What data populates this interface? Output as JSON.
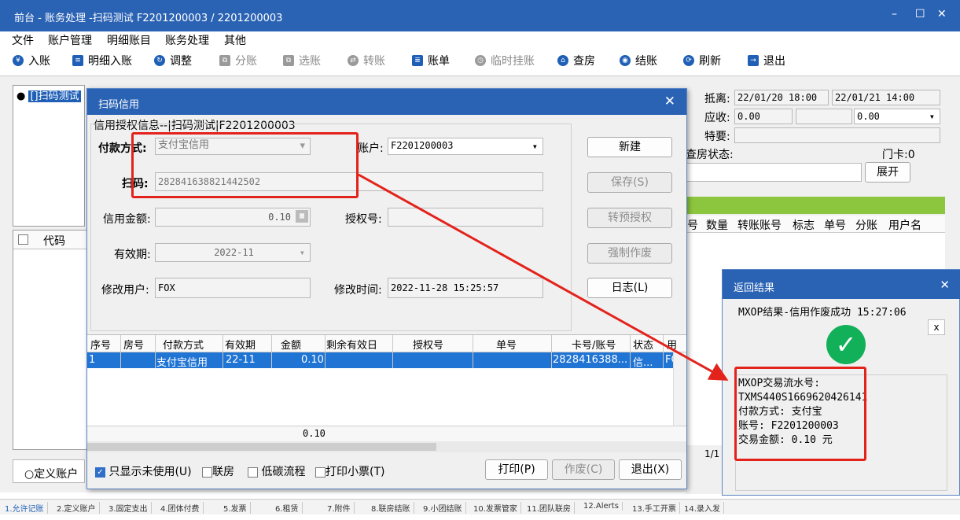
{
  "window": {
    "title": "前台 - 账务处理 -扫码测试  F2201200003  /  2201200003",
    "controls": {
      "minimize": "–",
      "maximize": "☐",
      "close": "✕"
    }
  },
  "menu": [
    "文件",
    "账户管理",
    "明细账目",
    "账务处理",
    "其他"
  ],
  "toolbar": {
    "items": [
      {
        "label": "入账",
        "icon": "yen-icon",
        "enabled": true
      },
      {
        "label": "明细入账",
        "icon": "ledger-icon",
        "enabled": true
      },
      {
        "label": "调整",
        "icon": "adjust-icon",
        "enabled": true
      },
      {
        "label": "分账",
        "icon": "split-icon",
        "enabled": false
      },
      {
        "label": "选账",
        "icon": "select-icon",
        "enabled": false
      },
      {
        "label": "转账",
        "icon": "transfer-icon",
        "enabled": false
      },
      {
        "label": "账单",
        "icon": "bill-icon",
        "enabled": true
      },
      {
        "label": "临时挂账",
        "icon": "clock-icon",
        "enabled": false
      },
      {
        "label": "查房",
        "icon": "house-icon",
        "enabled": true
      },
      {
        "label": "结账",
        "icon": "coins-icon",
        "enabled": true
      },
      {
        "label": "刷新",
        "icon": "refresh-icon",
        "enabled": true
      },
      {
        "label": "退出",
        "icon": "exit-icon",
        "enabled": true
      }
    ]
  },
  "tree": {
    "node_label": "[]扫码测试"
  },
  "code_grid": {
    "header": "代码"
  },
  "bottom_left": {
    "radio_label": "定义账户"
  },
  "right_panel": {
    "depart_label": "抵离:",
    "depart_from": "22/01/20 18:00",
    "depart_to": "22/01/21 14:00",
    "receivable_label": "应收:",
    "receivable_value": "0.00",
    "receivable_value2": "0.00",
    "special_label": "特要:",
    "checkroom_label": "查房状态:",
    "door_card_label": "门卡:",
    "door_card_value": "0",
    "expand_button": "展开",
    "grid_headers": [
      "号",
      "数量",
      "转账账号",
      "标志",
      "单号",
      "分账",
      "用户名"
    ],
    "page_info": "1/1"
  },
  "dialog": {
    "title": "扫码信用",
    "close": "✕",
    "group_title": "信用授权信息--|扫码测试|F2201200003",
    "pay_method_label": "付款方式:",
    "pay_method_value": "支付宝信用",
    "account_label": "账户:",
    "account_value": "F2201200003",
    "scan_label": "扫码:",
    "scan_value": "282841638821442502",
    "credit_amount_label": "信用金额:",
    "credit_amount_value": "0.10",
    "auth_no_label": "授权号:",
    "auth_no_value": "",
    "expiry_label": "有效期:",
    "expiry_value": "2022-11",
    "modify_user_label": "修改用户:",
    "modify_user_value": "FOX",
    "modify_time_label": "修改时间:",
    "modify_time_value": "2022-11-28 15:25:57",
    "buttons": {
      "new": "新建",
      "save": "保存(S)",
      "to_preauth": "转预授权",
      "force_void": "强制作废",
      "log": "日志(L)"
    },
    "grid": {
      "headers": [
        "序号",
        "房号",
        "付款方式",
        "有效期",
        "金额",
        "剩余有效日",
        "授权号",
        "单号",
        "卡号/账号",
        "状态",
        "用"
      ],
      "rows": [
        [
          "1",
          "",
          "支付宝信用",
          "22-11",
          "0.10",
          "",
          "",
          "",
          "2828416388...",
          "信...",
          "FO"
        ]
      ],
      "total": "0.10"
    },
    "footer": {
      "only_unused": "只显示未使用(U)",
      "only_unused_checked": true,
      "joint_room": "联房",
      "low_carbon": "低碳流程",
      "print_receipt": "打印小票(T)",
      "print": "打印(P)",
      "void": "作废(C)",
      "exit": "退出(X)"
    }
  },
  "result_dialog": {
    "title": "返回结果",
    "close": "✕",
    "message": "MXOP结果-信用作废成功 15:27:06",
    "small_close": "x",
    "details": [
      "MXOP交易流水号:",
      "TXMS440S1669620426141",
      "付款方式: 支付宝",
      "账号: F2201200003",
      "交易金额: 0.10 元"
    ]
  },
  "status_tabs": [
    "1.允许记账",
    "2.定义账户",
    "3.固定支出",
    "4.团体付费",
    "5.发票",
    "6.租赁",
    "7.附件",
    "8.联房结账",
    "9.小团结账",
    "10.发票管家",
    "11.团队联房",
    "12.Alerts",
    "13.手工开票",
    "14.录入发"
  ],
  "colors": {
    "titlebar": "#2b63b4",
    "selection": "#1f74d4",
    "highlight_red": "#e3231b",
    "success_green": "#13b05a",
    "status_bar_green": "#8cc63f"
  }
}
